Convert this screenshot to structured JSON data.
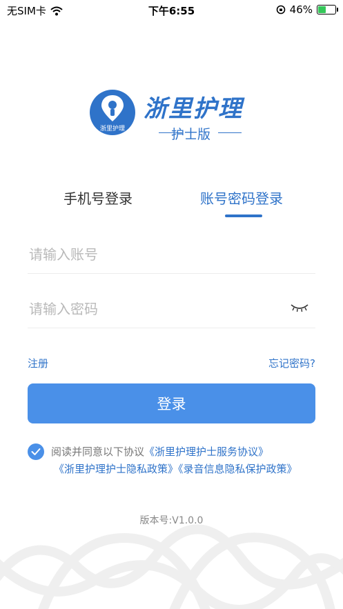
{
  "status_bar": {
    "carrier": "无SIM卡",
    "time": "下午6:55",
    "battery_percent": "46%",
    "battery_level": 0.46
  },
  "logo": {
    "circle_label": "浙里护理",
    "title": "浙里护理",
    "subtitle": "护士版"
  },
  "tabs": [
    {
      "label": "手机号登录",
      "active": false
    },
    {
      "label": "账号密码登录",
      "active": true
    }
  ],
  "form": {
    "account_placeholder": "请输入账号",
    "password_placeholder": "请输入密码",
    "account_value": "",
    "password_value": ""
  },
  "links": {
    "register": "注册",
    "forgot_password": "忘记密码?"
  },
  "login_button": "登录",
  "agreement": {
    "checked": true,
    "prefix": "阅读并同意以下协议",
    "service": "《浙里护理护士服务协议》",
    "privacy": "《浙里护理护士隐私政策》",
    "recording": "《录音信息隐私保护政策》"
  },
  "version": "版本号:V1.0.0",
  "colors": {
    "accent": "#2f73c9",
    "button": "#4a90e8"
  }
}
